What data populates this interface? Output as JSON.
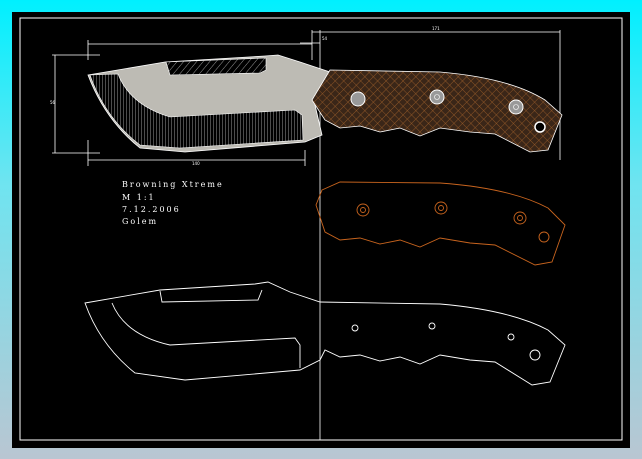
{
  "title_block": {
    "name": "Browning Xtreme",
    "scale": "M 1:1",
    "date": "7.12.2006",
    "author": "Golem"
  },
  "dimensions": {
    "overall_length": "171",
    "blade_length": "140",
    "blade_height": "56",
    "handle_offset": "54"
  },
  "colors": {
    "background": "#000000",
    "frame": "#ffffff",
    "blade_fill": "#bdbbb4",
    "handle_fill": "#3a2618",
    "handle_hatch": "#a0602a",
    "handle_outline": "#c8641e"
  }
}
